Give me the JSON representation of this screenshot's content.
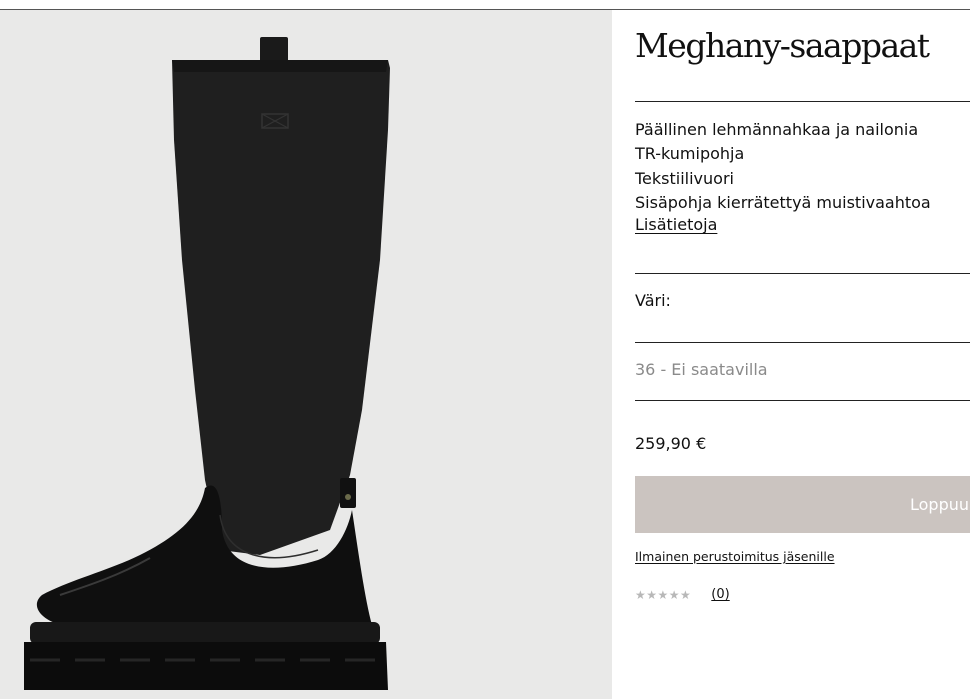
{
  "product": {
    "title": "Meghany-saappaat",
    "features": [
      "Päällinen lehmännahkaa ja nailonia",
      "TR-kumipohja",
      "Tekstiilivuori",
      "Sisäpohja kierrätettyä muistivaahtoa"
    ],
    "more_link": "Lisätietoja",
    "color_label": "Väri:",
    "size_selected": "36 - Ei saatavilla",
    "price": "259,90 €",
    "sold_out_label": "Loppuunmyyty",
    "shipping_link": "Ilmainen perustoimitus jäsenille",
    "rating": {
      "stars": "★★★★★",
      "count": "(0)",
      "star_color": "#b8b8b8"
    }
  },
  "colors": {
    "image_background": "#e9e9e8",
    "button_background": "#cbc4c0",
    "boot": "#151515"
  }
}
